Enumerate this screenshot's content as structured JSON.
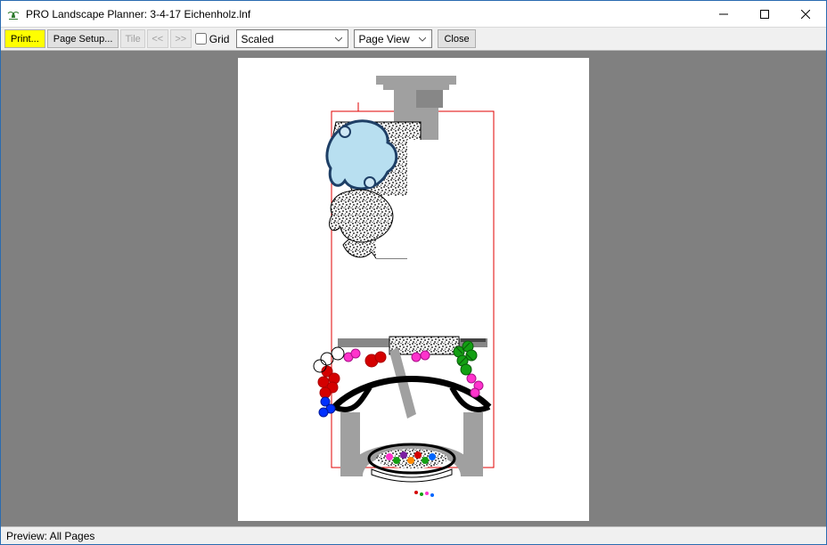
{
  "title": "PRO Landscape Planner: 3-4-17 Eichenholz.lnf",
  "toolbar": {
    "print": "Print...",
    "page_setup": "Page Setup...",
    "tile": "Tile",
    "prev": "<<",
    "next": ">>",
    "grid_label": "Grid",
    "grid_checked": false,
    "scale": "Scaled",
    "page_view": "Page View",
    "close": "Close"
  },
  "status": "Preview: All Pages"
}
